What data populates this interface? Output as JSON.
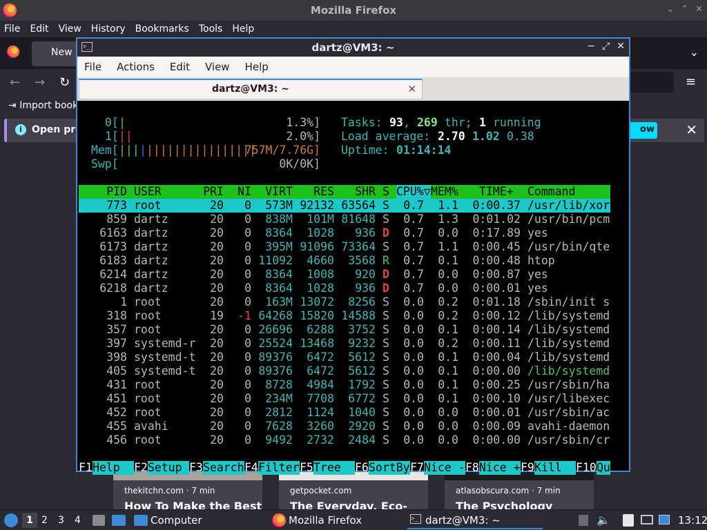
{
  "firefox": {
    "window_title": "Mozilla Firefox",
    "menu": [
      "File",
      "Edit",
      "View",
      "History",
      "Bookmarks",
      "Tools",
      "Help"
    ],
    "tab_label": "New",
    "bookmark": "Import book",
    "infobar_msg": "Open pre",
    "infobar_btn": "ow",
    "cards": [
      {
        "source": "thekitchn.com · 7 min",
        "headline": "How To Make the Best"
      },
      {
        "source": "getpocket.com",
        "headline": "The Everyday, Eco-"
      },
      {
        "source": "atlasobscura.com · 7 min",
        "headline": "The Psychology"
      }
    ]
  },
  "terminal": {
    "title": "dartz@VM3: ~",
    "tab_title": "dartz@VM3: ~",
    "menu": [
      "File",
      "Actions",
      "Edit",
      "View",
      "Help"
    ]
  },
  "htop": {
    "cpu0_label": "0[",
    "cpu0_bar": "|",
    "cpu0_value": "1.3%]",
    "cpu1_label": "1[",
    "cpu1_bar": "||",
    "cpu1_value": "2.0%]",
    "mem_label": "Mem[",
    "mem_bar_green": "|||",
    "mem_bar_blue": "|",
    "mem_bar_orange": "||||||||||||||||",
    "mem_value": "757M/7.76G]",
    "swp_label": "Swp[",
    "swp_value": "0K/0K]",
    "tasks_label": "Tasks:",
    "tasks_count": "93",
    "threads": "269",
    "thr_label": "thr;",
    "running": "1",
    "running_label": "running",
    "load_label": "Load average:",
    "load1": "2.70",
    "load5": "1.02",
    "load15": "0.38",
    "uptime_label": "Uptime:",
    "uptime": "01:14:14",
    "columns": [
      "PID",
      "USER",
      "PRI",
      "NI",
      "VIRT",
      "RES",
      "SHR",
      "S",
      "CPU%▽",
      "MEM%",
      "TIME+",
      "Command"
    ],
    "processes": [
      {
        "pid": "773",
        "user": "root",
        "pri": "20",
        "ni": "0",
        "virt": "573M",
        "res": "92132",
        "shr": "63564",
        "s": "S",
        "cpu": "0.7",
        "mem": "1.1",
        "time": "0:00.37",
        "cmd": "/usr/lib/xor"
      },
      {
        "pid": "859",
        "user": "dartz",
        "pri": "20",
        "ni": "0",
        "virt": "838M",
        "res": "101M",
        "shr": "81648",
        "s": "S",
        "cpu": "0.7",
        "mem": "1.3",
        "time": "0:01.02",
        "cmd": "/usr/bin/pcm"
      },
      {
        "pid": "6163",
        "user": "dartz",
        "pri": "20",
        "ni": "0",
        "virt": "8364",
        "res": "1028",
        "shr": "936",
        "s": "D",
        "cpu": "0.7",
        "mem": "0.0",
        "time": "0:17.89",
        "cmd": "yes"
      },
      {
        "pid": "6173",
        "user": "dartz",
        "pri": "20",
        "ni": "0",
        "virt": "395M",
        "res": "91096",
        "shr": "73364",
        "s": "S",
        "cpu": "0.7",
        "mem": "1.1",
        "time": "0:00.45",
        "cmd": "/usr/bin/qte"
      },
      {
        "pid": "6183",
        "user": "dartz",
        "pri": "20",
        "ni": "0",
        "virt": "11092",
        "res": "4660",
        "shr": "3568",
        "s": "R",
        "cpu": "0.7",
        "mem": "0.1",
        "time": "0:00.48",
        "cmd": "htop"
      },
      {
        "pid": "6214",
        "user": "dartz",
        "pri": "20",
        "ni": "0",
        "virt": "8364",
        "res": "1008",
        "shr": "920",
        "s": "D",
        "cpu": "0.7",
        "mem": "0.0",
        "time": "0:00.87",
        "cmd": "yes"
      },
      {
        "pid": "6218",
        "user": "dartz",
        "pri": "20",
        "ni": "0",
        "virt": "8364",
        "res": "1028",
        "shr": "936",
        "s": "D",
        "cpu": "0.7",
        "mem": "0.0",
        "time": "0:00.01",
        "cmd": "yes"
      },
      {
        "pid": "1",
        "user": "root",
        "pri": "20",
        "ni": "0",
        "virt": "163M",
        "res": "13072",
        "shr": "8256",
        "s": "S",
        "cpu": "0.0",
        "mem": "0.2",
        "time": "0:01.18",
        "cmd": "/sbin/init s"
      },
      {
        "pid": "318",
        "user": "root",
        "pri": "19",
        "ni": "-1",
        "virt": "64268",
        "res": "15820",
        "shr": "14588",
        "s": "S",
        "cpu": "0.0",
        "mem": "0.2",
        "time": "0:00.12",
        "cmd": "/lib/systemd"
      },
      {
        "pid": "357",
        "user": "root",
        "pri": "20",
        "ni": "0",
        "virt": "26696",
        "res": "6288",
        "shr": "3752",
        "s": "S",
        "cpu": "0.0",
        "mem": "0.1",
        "time": "0:00.14",
        "cmd": "/lib/systemd"
      },
      {
        "pid": "397",
        "user": "systemd-r",
        "pri": "20",
        "ni": "0",
        "virt": "25524",
        "res": "13468",
        "shr": "9232",
        "s": "S",
        "cpu": "0.0",
        "mem": "0.2",
        "time": "0:00.11",
        "cmd": "/lib/systemd"
      },
      {
        "pid": "398",
        "user": "systemd-t",
        "pri": "20",
        "ni": "0",
        "virt": "89376",
        "res": "6472",
        "shr": "5612",
        "s": "S",
        "cpu": "0.0",
        "mem": "0.1",
        "time": "0:00.04",
        "cmd": "/lib/systemd"
      },
      {
        "pid": "405",
        "user": "systemd-t",
        "pri": "20",
        "ni": "0",
        "virt": "89376",
        "res": "6472",
        "shr": "5612",
        "s": "S",
        "cpu": "0.0",
        "mem": "0.1",
        "time": "0:00.00",
        "cmd": "/lib/systemd"
      },
      {
        "pid": "431",
        "user": "root",
        "pri": "20",
        "ni": "0",
        "virt": "8728",
        "res": "4984",
        "shr": "1792",
        "s": "S",
        "cpu": "0.0",
        "mem": "0.1",
        "time": "0:00.25",
        "cmd": "/usr/sbin/ha"
      },
      {
        "pid": "451",
        "user": "root",
        "pri": "20",
        "ni": "0",
        "virt": "234M",
        "res": "7708",
        "shr": "6772",
        "s": "S",
        "cpu": "0.0",
        "mem": "0.1",
        "time": "0:00.10",
        "cmd": "/usr/libexec"
      },
      {
        "pid": "452",
        "user": "root",
        "pri": "20",
        "ni": "0",
        "virt": "2812",
        "res": "1124",
        "shr": "1040",
        "s": "S",
        "cpu": "0.0",
        "mem": "0.0",
        "time": "0:00.01",
        "cmd": "/usr/sbin/ac"
      },
      {
        "pid": "455",
        "user": "avahi",
        "pri": "20",
        "ni": "0",
        "virt": "7628",
        "res": "3260",
        "shr": "2920",
        "s": "S",
        "cpu": "0.0",
        "mem": "0.0",
        "time": "0:00.09",
        "cmd": "avahi-daemon"
      },
      {
        "pid": "456",
        "user": "root",
        "pri": "20",
        "ni": "0",
        "virt": "9492",
        "res": "2732",
        "shr": "2484",
        "s": "S",
        "cpu": "0.0",
        "mem": "0.0",
        "time": "0:00.00",
        "cmd": "/usr/sbin/cr"
      }
    ],
    "fkeys": [
      {
        "key": "F1",
        "label": "Help  "
      },
      {
        "key": "F2",
        "label": "Setup "
      },
      {
        "key": "F3",
        "label": "Search"
      },
      {
        "key": "F4",
        "label": "Filter"
      },
      {
        "key": "F5",
        "label": "Tree  "
      },
      {
        "key": "F6",
        "label": "SortBy"
      },
      {
        "key": "F7",
        "label": "Nice -"
      },
      {
        "key": "F8",
        "label": "Nice +"
      },
      {
        "key": "F9",
        "label": "Kill  "
      },
      {
        "key": "F10",
        "label": "Qu"
      }
    ]
  },
  "taskbar": {
    "workspaces": [
      "1",
      "2",
      "3",
      "4"
    ],
    "items": [
      "Computer",
      "Mozilla Firefox",
      "dartz@VM3: ~"
    ],
    "clock": "13:12"
  }
}
